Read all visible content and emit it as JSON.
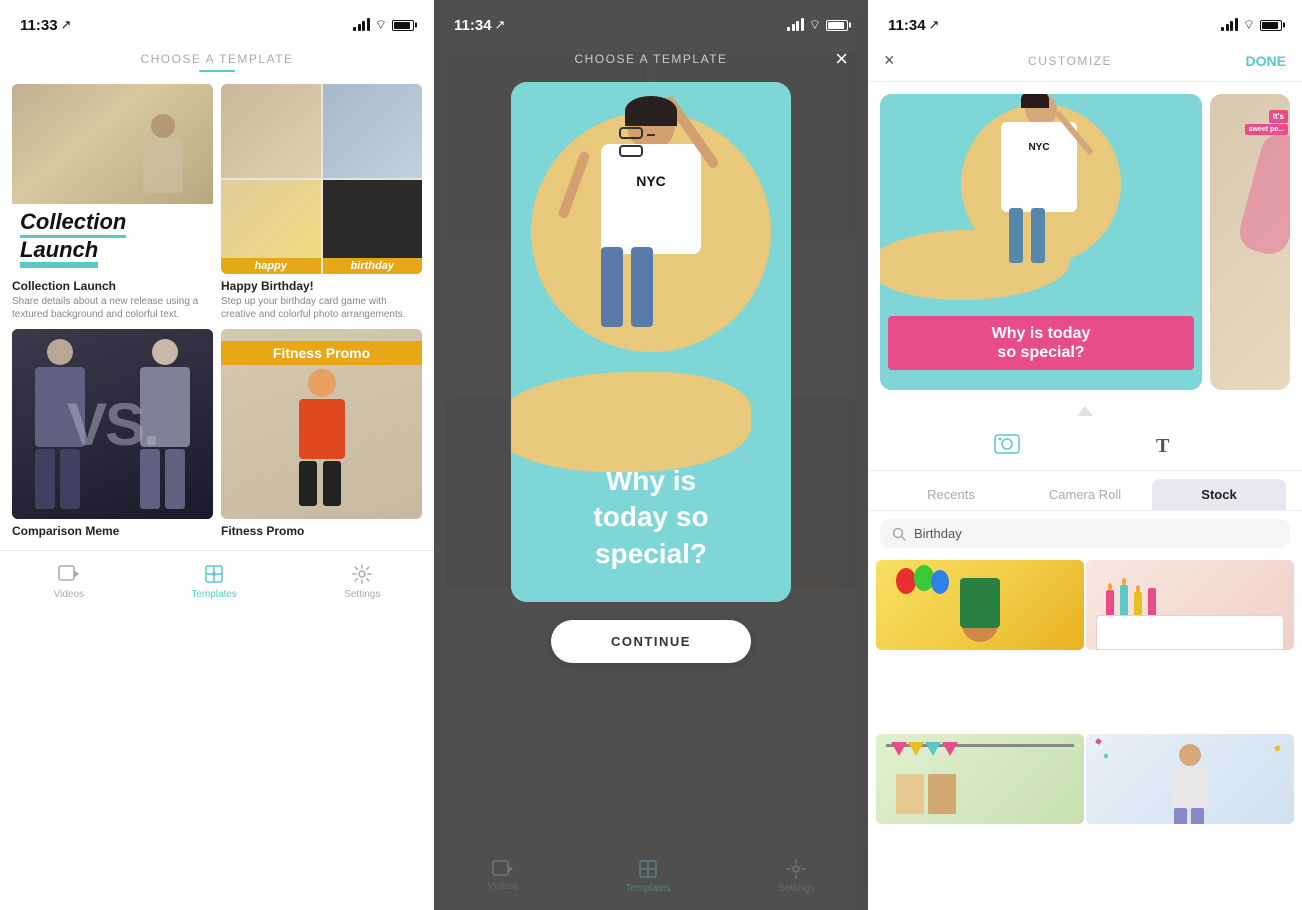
{
  "phone1": {
    "status": {
      "time": "11:33",
      "location": "↗"
    },
    "header": {
      "title": "CHOOSE A TEMPLATE"
    },
    "templates": [
      {
        "id": "collection-launch",
        "name": "Collection Launch",
        "description": "Share details about a new release using a textured background and colorful text.",
        "overlay_text_line1": "Collection",
        "overlay_text_line2": "Launch"
      },
      {
        "id": "happy-birthday",
        "name": "Happy Birthday!",
        "description": "Step up your birthday card game with creative and colorful photo arrangements.",
        "overlay_text_line1": "happy",
        "overlay_text_line2": "birthday"
      },
      {
        "id": "comparison-meme",
        "name": "Comparison Meme",
        "description": "",
        "overlay_text": "VS."
      },
      {
        "id": "fitness-promo",
        "name": "Fitness Promo",
        "description": "",
        "overlay_text": "Fitness Promo"
      }
    ],
    "tabs": [
      {
        "id": "videos",
        "label": "Videos",
        "active": false
      },
      {
        "id": "templates",
        "label": "Templates",
        "active": true
      },
      {
        "id": "settings",
        "label": "Settings",
        "active": false
      }
    ]
  },
  "phone2": {
    "status": {
      "time": "11:34",
      "location": "↗"
    },
    "header": {
      "title": "CHOOSE A TEMPLATE",
      "close": "×"
    },
    "preview": {
      "main_text": "Why is\ntoday so\nspecial?"
    },
    "continue_button": "CONTINUE"
  },
  "phone3": {
    "status": {
      "time": "11:34",
      "location": "↗"
    },
    "header": {
      "close": "×",
      "title": "CUSTOMIZE",
      "done": "DONE"
    },
    "preview": {
      "pink_text_line1": "Why is today",
      "pink_text_line2": "so special?",
      "card2_text1": "It's",
      "card2_text2": "sweet pe..."
    },
    "photo_tabs": [
      {
        "id": "recents",
        "label": "Recents",
        "active": false
      },
      {
        "id": "camera-roll",
        "label": "Camera Roll",
        "active": false
      },
      {
        "id": "stock",
        "label": "Stock",
        "active": true
      }
    ],
    "search": {
      "placeholder": "Birthday",
      "value": "Birthday"
    },
    "photos": [
      {
        "id": "photo1",
        "alt": "Birthday kid with balloons"
      },
      {
        "id": "photo2",
        "alt": "Birthday candles on cake"
      },
      {
        "id": "photo3",
        "alt": "Birthday table decoration"
      },
      {
        "id": "photo4",
        "alt": "Birthday celebration"
      }
    ]
  }
}
